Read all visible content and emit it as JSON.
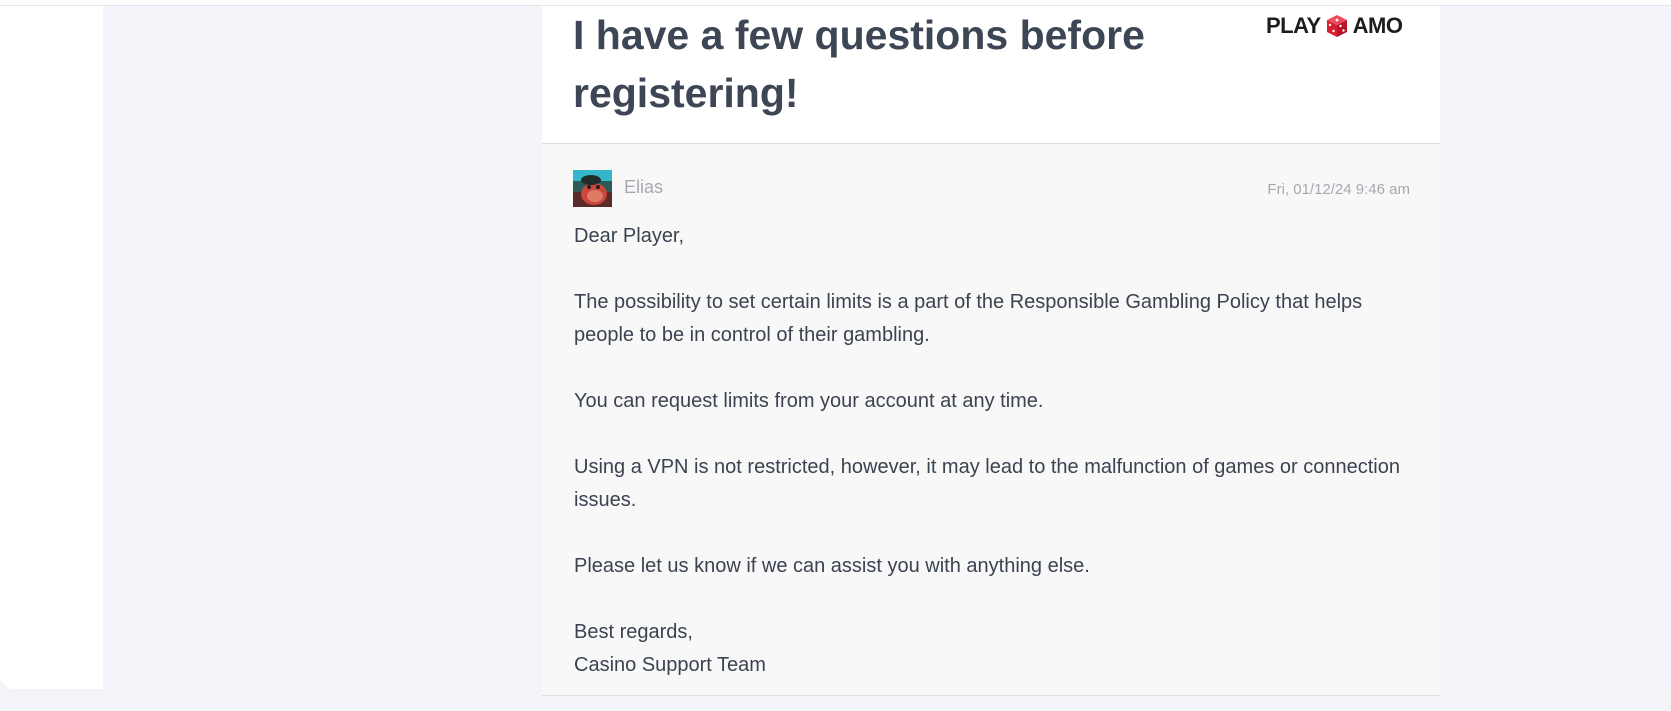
{
  "ticket": {
    "title": "I have a few questions before registering!",
    "brand": {
      "left": "PLAY",
      "right": "AMO",
      "icon": "dice-icon"
    }
  },
  "message": {
    "author": "Elias",
    "timestamp": "Fri, 01/12/24 9:46 am",
    "avatar_icon": "avatar-image",
    "paragraphs": [
      "Dear Player,",
      "The possibility to set certain limits is a part of the Responsible Gambling Policy that helps people to be in control of their gambling.",
      "You can request limits from your account at any time.",
      "Using a VPN is not restricted, however, it may lead to the malfunction of games or connection issues.",
      "Please let us know if we can assist you with anything else."
    ],
    "signoff": "Best regards,",
    "signature": "Casino Support Team"
  },
  "colors": {
    "title": "#3d4654",
    "body_text": "#3b4350",
    "muted_text": "#a5a9af",
    "page_background": "#f4f5fa",
    "message_background": "#f8f8f9",
    "brand_red": "#e2263a"
  }
}
